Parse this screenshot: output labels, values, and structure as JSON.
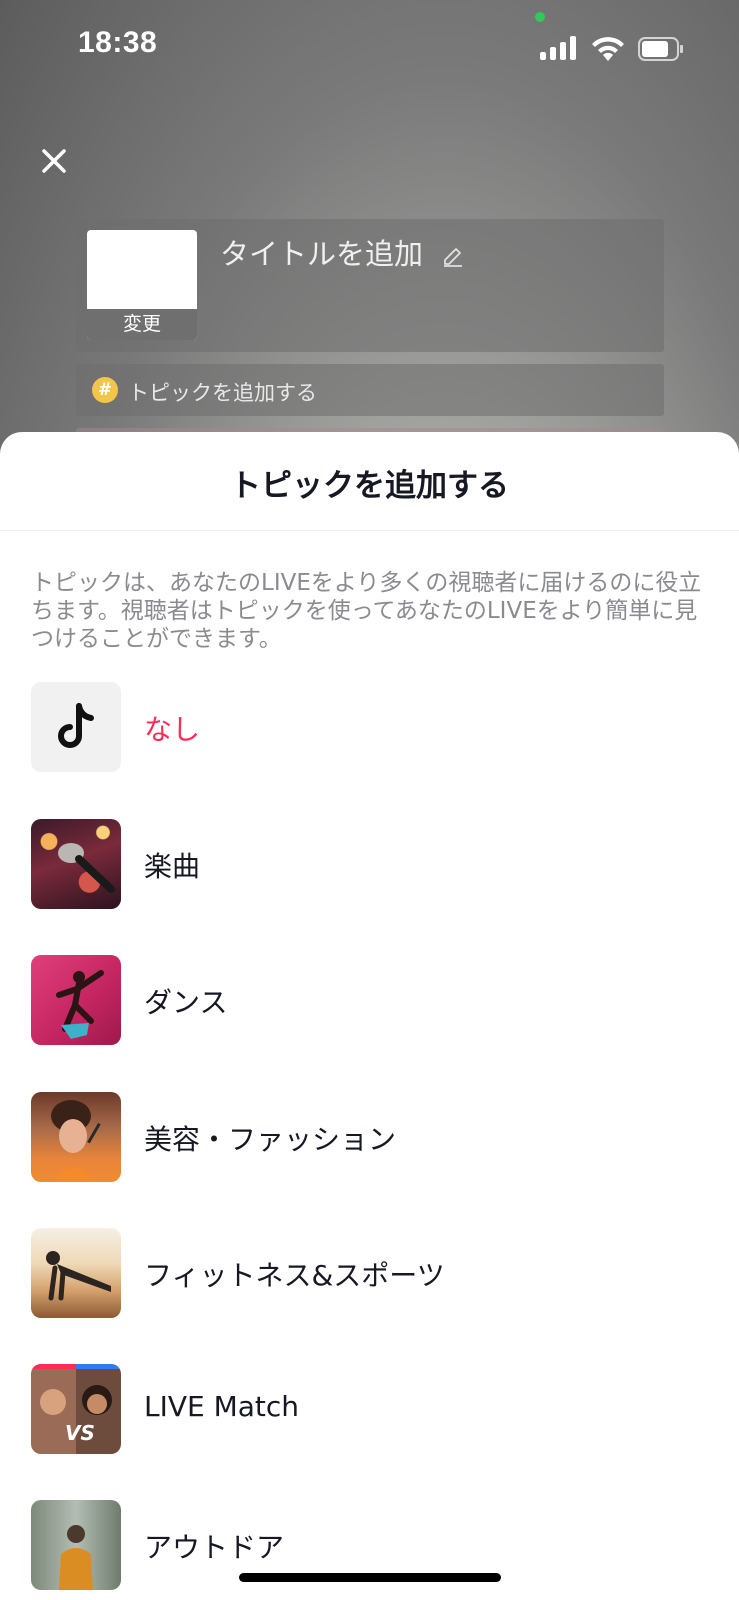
{
  "status_bar": {
    "time": "18:38"
  },
  "setup": {
    "thumbnail_change_label": "変更",
    "title_placeholder": "タイトルを追加",
    "topic_button_label": "トピックを追加する"
  },
  "sheet": {
    "title": "トピックを追加する",
    "description": "トピックは、あなたのLIVEをより多くの視聴者に届けるのに役立ちます。視聴者はトピックを使ってあなたのLIVEをより簡単に見つけることができます。",
    "topics": [
      {
        "label": "なし",
        "icon": "tiktok-logo-icon",
        "selected": true
      },
      {
        "label": "楽曲",
        "icon": "microphone-photo",
        "selected": false
      },
      {
        "label": "ダンス",
        "icon": "dancer-photo",
        "selected": false
      },
      {
        "label": "美容・ファッション",
        "icon": "makeup-photo",
        "selected": false
      },
      {
        "label": "フィットネス&スポーツ",
        "icon": "pushup-photo",
        "selected": false
      },
      {
        "label": "LIVE Match",
        "icon": "versus-photo",
        "selected": false
      },
      {
        "label": "アウトドア",
        "icon": "hiker-photo",
        "selected": false
      }
    ]
  },
  "colors": {
    "accent": "#fe2c55",
    "text": "#161823",
    "muted": "#8a8b91"
  }
}
